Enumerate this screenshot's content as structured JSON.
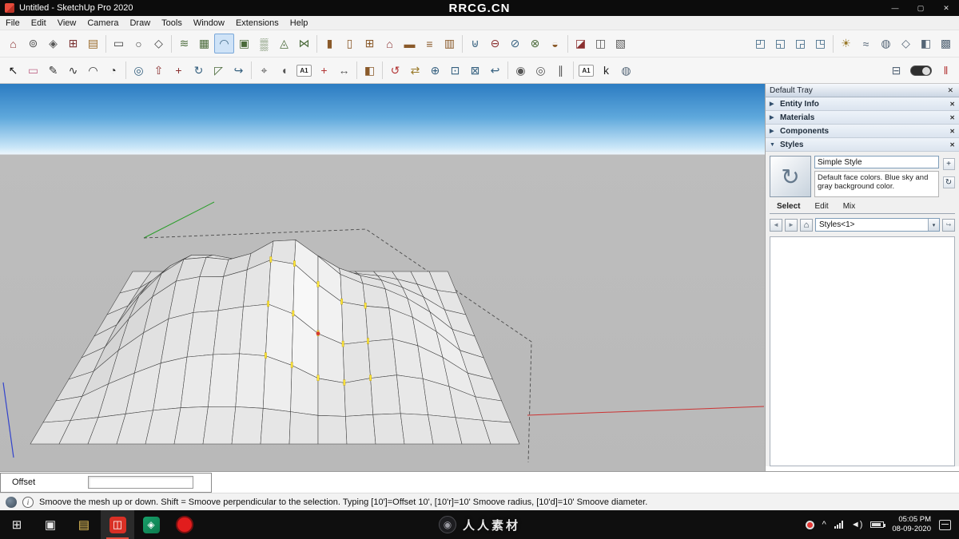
{
  "window": {
    "title": "Untitled - SketchUp Pro 2020",
    "watermark": "RRCG.CN",
    "controls": {
      "minimize": "—",
      "maximize": "▢",
      "close": "✕"
    }
  },
  "menus": [
    "File",
    "Edit",
    "View",
    "Camera",
    "Draw",
    "Tools",
    "Window",
    "Extensions",
    "Help"
  ],
  "toolbar_row1": [
    {
      "name": "3d-warehouse",
      "glyph": "⌂",
      "color": "#8a2f2f"
    },
    {
      "name": "share-model",
      "glyph": "⊚",
      "color": "#555555"
    },
    {
      "name": "share-component",
      "glyph": "◈",
      "color": "#555555"
    },
    {
      "name": "extension-warehouse",
      "glyph": "⊞",
      "color": "#7a3030"
    },
    {
      "name": "send-to-layout",
      "glyph": "▤",
      "color": "#9a6a2a"
    },
    {
      "sep": true
    },
    {
      "name": "rectangle-tool",
      "glyph": "▭",
      "color": "#444444"
    },
    {
      "name": "circle-tool",
      "glyph": "○",
      "color": "#444444"
    },
    {
      "name": "polygon-tool",
      "glyph": "◇",
      "color": "#444444"
    },
    {
      "sep": true
    },
    {
      "name": "sandbox-from-contours",
      "glyph": "≋",
      "color": "#4a6a3a"
    },
    {
      "name": "sandbox-from-scratch",
      "glyph": "▦",
      "color": "#4a6a3a"
    },
    {
      "name": "sandbox-smoove",
      "glyph": "◠",
      "color": "#35607f",
      "active": true
    },
    {
      "name": "sandbox-stamp",
      "glyph": "▣",
      "color": "#4a6a3a"
    },
    {
      "name": "sandbox-drape",
      "glyph": "▒",
      "color": "#4a6a3a"
    },
    {
      "name": "sandbox-add-detail",
      "glyph": "◬",
      "color": "#4a6a3a"
    },
    {
      "name": "sandbox-flip-edge",
      "glyph": "⋈",
      "color": "#4a6a3a"
    },
    {
      "sep": true
    },
    {
      "name": "wall-tool",
      "glyph": "▮",
      "color": "#8a5a2a"
    },
    {
      "name": "door-tool",
      "glyph": "▯",
      "color": "#8a5a2a"
    },
    {
      "name": "window-tool",
      "glyph": "⊞",
      "color": "#8a5a2a"
    },
    {
      "name": "roof-tool",
      "glyph": "⌂",
      "color": "#8a2f2f"
    },
    {
      "name": "floor-tool",
      "glyph": "▬",
      "color": "#8a5a2a"
    },
    {
      "name": "stairs-tool",
      "glyph": "≡",
      "color": "#8a5a2a"
    },
    {
      "name": "column-tool",
      "glyph": "▥",
      "color": "#8a5a2a"
    },
    {
      "sep": true
    },
    {
      "name": "solid-union",
      "glyph": "⊎",
      "color": "#35607f"
    },
    {
      "name": "solid-subtract",
      "glyph": "⊖",
      "color": "#8a2f2f"
    },
    {
      "name": "solid-trim",
      "glyph": "⊘",
      "color": "#35607f"
    },
    {
      "name": "solid-intersect",
      "glyph": "⊗",
      "color": "#4a6a3a"
    },
    {
      "name": "solid-split",
      "glyph": "◒",
      "color": "#8a5a2a"
    },
    {
      "sep": true
    },
    {
      "name": "section-plane",
      "glyph": "◪",
      "color": "#8a2f2f"
    },
    {
      "name": "section-display",
      "glyph": "◫",
      "color": "#555555"
    },
    {
      "name": "section-fill",
      "glyph": "▧",
      "color": "#555555"
    },
    {
      "spacer": true
    },
    {
      "name": "view-iso",
      "glyph": "◰",
      "color": "#35607f"
    },
    {
      "name": "view-top",
      "glyph": "◱",
      "color": "#35607f"
    },
    {
      "name": "view-front",
      "glyph": "◲",
      "color": "#35607f"
    },
    {
      "name": "view-right",
      "glyph": "◳",
      "color": "#35607f"
    },
    {
      "sep": true
    },
    {
      "name": "shadows-toggle",
      "glyph": "☀",
      "color": "#9a7a2a"
    },
    {
      "name": "fog-toggle",
      "glyph": "≈",
      "color": "#556677"
    },
    {
      "name": "x-ray-mode",
      "glyph": "◍",
      "color": "#556677"
    },
    {
      "name": "wireframe-mode",
      "glyph": "◇",
      "color": "#556677"
    },
    {
      "name": "shaded-mode",
      "glyph": "◧",
      "color": "#556677"
    },
    {
      "name": "textured-mode",
      "glyph": "▩",
      "color": "#556677"
    }
  ],
  "toolbar_row2": [
    {
      "name": "select-tool",
      "glyph": "↖",
      "color": "#111111"
    },
    {
      "name": "eraser-tool",
      "glyph": "▭",
      "color": "#c06a8a"
    },
    {
      "name": "line-tool",
      "glyph": "✎",
      "color": "#333333"
    },
    {
      "name": "freehand-tool",
      "glyph": "∿",
      "color": "#333333"
    },
    {
      "name": "arc-tool",
      "glyph": "◠",
      "color": "#333333"
    },
    {
      "name": "pie-tool",
      "glyph": "◔",
      "color": "#333333"
    },
    {
      "sep": true
    },
    {
      "name": "offset-tool",
      "glyph": "◎",
      "color": "#35607f"
    },
    {
      "name": "push-pull-tool",
      "glyph": "⇧",
      "color": "#8a2f2f"
    },
    {
      "name": "move-tool",
      "glyph": "+",
      "color": "#8a2f2f"
    },
    {
      "name": "rotate-tool",
      "glyph": "↻",
      "color": "#35607f"
    },
    {
      "name": "scale-tool",
      "glyph": "◸",
      "color": "#4a6a3a"
    },
    {
      "name": "follow-me-tool",
      "glyph": "↪",
      "color": "#35607f"
    },
    {
      "sep": true
    },
    {
      "name": "tape-measure-tool",
      "glyph": "⌖",
      "color": "#555555"
    },
    {
      "name": "protractor-tool",
      "glyph": "◖",
      "color": "#555555"
    },
    {
      "name": "text-tool",
      "text": "A1",
      "color": "#222222"
    },
    {
      "name": "axes-tool",
      "glyph": "+",
      "color": "#b23333"
    },
    {
      "name": "dimension-tool",
      "glyph": "↔",
      "color": "#555555"
    },
    {
      "sep": true
    },
    {
      "name": "paint-bucket-tool",
      "glyph": "◧",
      "color": "#8a5a2a"
    },
    {
      "sep": true
    },
    {
      "name": "orbit-tool",
      "glyph": "↺",
      "color": "#b23333"
    },
    {
      "name": "pan-tool",
      "glyph": "⇄",
      "color": "#9a7a2a"
    },
    {
      "name": "zoom-tool",
      "glyph": "⊕",
      "color": "#35607f"
    },
    {
      "name": "zoom-window-tool",
      "glyph": "⊡",
      "color": "#35607f"
    },
    {
      "name": "zoom-extents-tool",
      "glyph": "⊠",
      "color": "#35607f"
    },
    {
      "name": "zoom-previous-tool",
      "glyph": "↩",
      "color": "#35607f"
    },
    {
      "sep": true
    },
    {
      "name": "position-camera-tool",
      "glyph": "◉",
      "color": "#555555"
    },
    {
      "name": "look-around-tool",
      "glyph": "◎",
      "color": "#555555"
    },
    {
      "name": "walk-tool",
      "glyph": "∥",
      "color": "#555555"
    },
    {
      "sep": true
    },
    {
      "name": "text-label-tool",
      "text": "A1",
      "color": "#222222"
    },
    {
      "name": "keyframe-animation-tool",
      "glyph": "k",
      "color": "#222222"
    },
    {
      "name": "camera-export-tool",
      "glyph": "◍",
      "color": "#556677"
    },
    {
      "spacer": true
    },
    {
      "name": "match-photo",
      "glyph": "⊟",
      "color": "#556677"
    },
    {
      "name": "terrain-toggle",
      "toggle": true
    },
    {
      "name": "animator",
      "glyph": "‖",
      "color": "#b23333"
    }
  ],
  "tray": {
    "title": "Default Tray",
    "close_glyph": "✕",
    "sections": [
      {
        "label": "Entity Info",
        "arrow": "▶"
      },
      {
        "label": "Materials",
        "arrow": "▶"
      },
      {
        "label": "Components",
        "arrow": "▶"
      },
      {
        "label": "Styles",
        "arrow": "▼"
      }
    ],
    "styles_panel": {
      "style_name": "Simple Style",
      "description": "Default face colors. Blue sky and gray background color.",
      "thumb_glyph": "↻",
      "tabs": [
        "Select",
        "Edit",
        "Mix"
      ],
      "dropdown_value": "Styles<1>",
      "buttons": {
        "create": "+",
        "update": "↻",
        "back": "◄",
        "forward": "►",
        "home": "⌂",
        "dropdown_arrow": "▾",
        "details": "↪"
      }
    }
  },
  "measurement": {
    "label": "Offset",
    "value": ""
  },
  "status": {
    "text": "Smoove the mesh up or down.  Shift = Smoove perpendicular to the selection.  Typing [10']=Offset 10', [10'r]=10' Smoove radius, [10'd]=10' Smoove diameter."
  },
  "taskbar": {
    "watermark": "人人素材",
    "time": "05:05 PM",
    "date": "08-09-2020",
    "icons": {
      "start": "⊞",
      "task_view": "▣",
      "explorer": "▤",
      "sketchup": "◫",
      "media": "◈",
      "watermark_logo": "◉",
      "chevron": "^",
      "speaker": "◄)"
    }
  },
  "colors": {
    "sky": "#2c7cc2",
    "ground": "#b9b9b9",
    "selection_yellow": "#ffe93c",
    "axis_red": "#cc3333",
    "axis_green": "#2a9e2a",
    "axis_blue": "#3344cc"
  }
}
